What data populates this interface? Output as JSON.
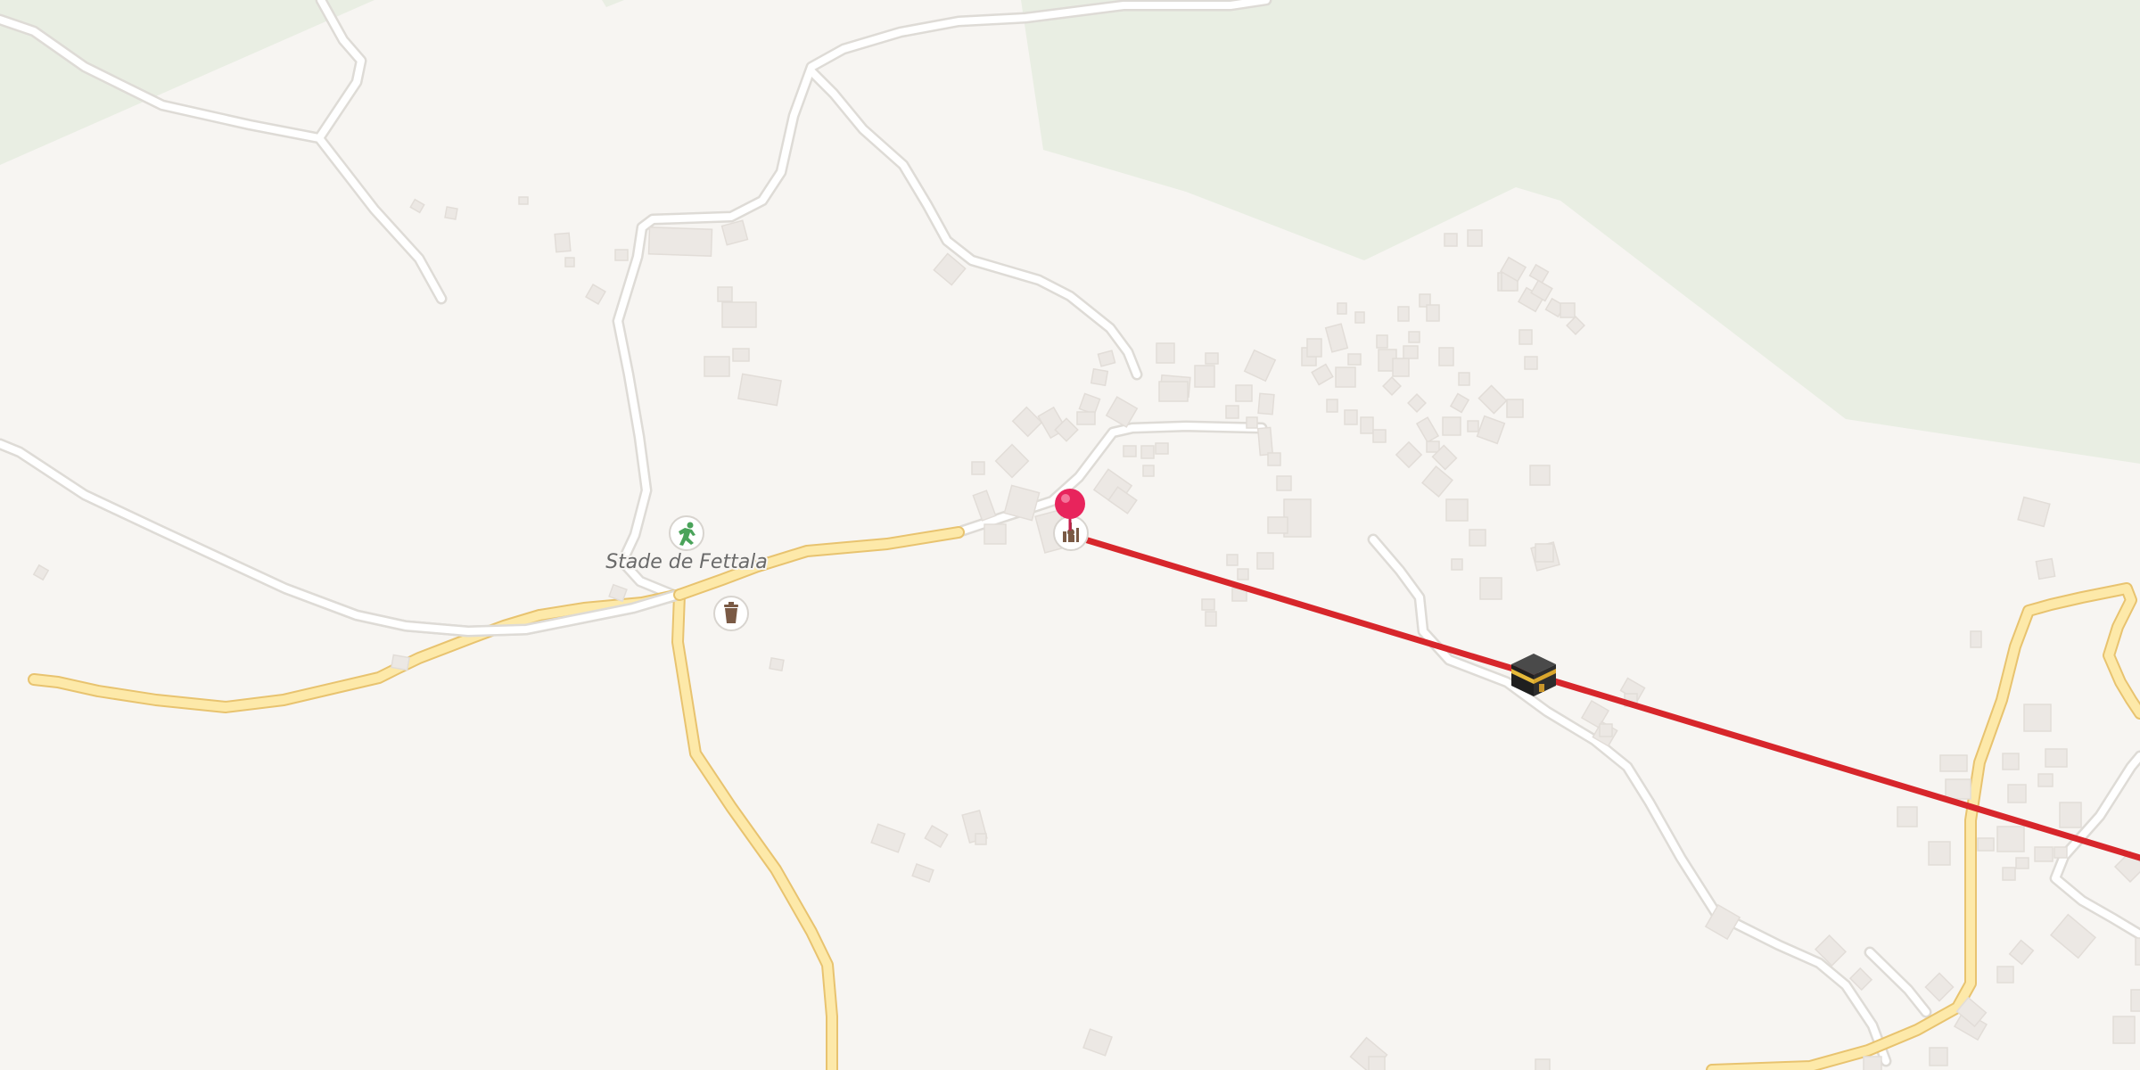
{
  "map": {
    "places": [
      {
        "name": "Stade de Fettala",
        "kind": "stadium"
      }
    ],
    "pois": [
      {
        "icon": "sports-running-icon",
        "category": "sports"
      },
      {
        "icon": "waste-bin-icon",
        "category": "amenity"
      },
      {
        "icon": "mosque-icon",
        "category": "place-of-worship"
      },
      {
        "icon": "kaaba-icon",
        "category": "qibla-direction"
      }
    ],
    "marker": {
      "icon": "location-pin-icon"
    },
    "qibla_line": {
      "color": "#d7262b"
    },
    "colors": {
      "land": "#f7f5f2",
      "vegetation": "#e9eee3",
      "minor_road": "#ffffff",
      "road_casing": "#dedbd6",
      "secondary_road": "#fde9a9",
      "secondary_casing": "#e8c36f",
      "building": "#ece8e4",
      "pin": "#e8245c"
    }
  }
}
